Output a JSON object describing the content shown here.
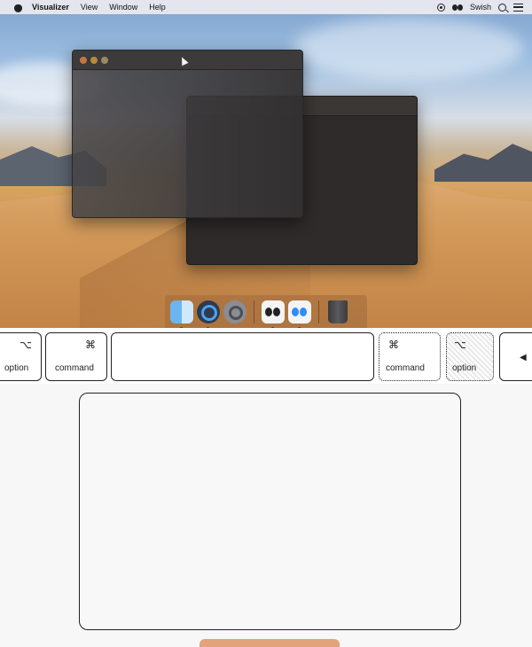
{
  "menubar": {
    "app_name": "Visualizer",
    "items": [
      "View",
      "Window",
      "Help"
    ],
    "status_app": "Swish",
    "icons": [
      "apple-icon",
      "screen-record-icon",
      "swish-icon",
      "spotlight-search-icon",
      "control-center-icon"
    ]
  },
  "windows": [
    {
      "name": "front-window",
      "state": "active"
    },
    {
      "name": "back-window",
      "state": "inactive"
    }
  ],
  "dock": {
    "apps": [
      "finder-icon",
      "quicktime-icon",
      "system-preferences-icon",
      "swish-icon",
      "swish-alt-icon",
      "trash-icon"
    ]
  },
  "keyboard": {
    "option_left": {
      "symbol": "⌥",
      "label": "option"
    },
    "command_left": {
      "symbol": "⌘",
      "label": "command"
    },
    "command_right": {
      "symbol": "⌘",
      "label": "command"
    },
    "option_right": {
      "symbol": "⌥",
      "label": "option"
    },
    "arrow_left": {
      "symbol": "◀"
    }
  },
  "colors": {
    "menubar_bg": "#ebebf0",
    "window_bg": "#2e2b2a",
    "dock_bg": "#a0693c",
    "trackpad_border": "#222222",
    "bottom_bar": "#e2a27a"
  }
}
